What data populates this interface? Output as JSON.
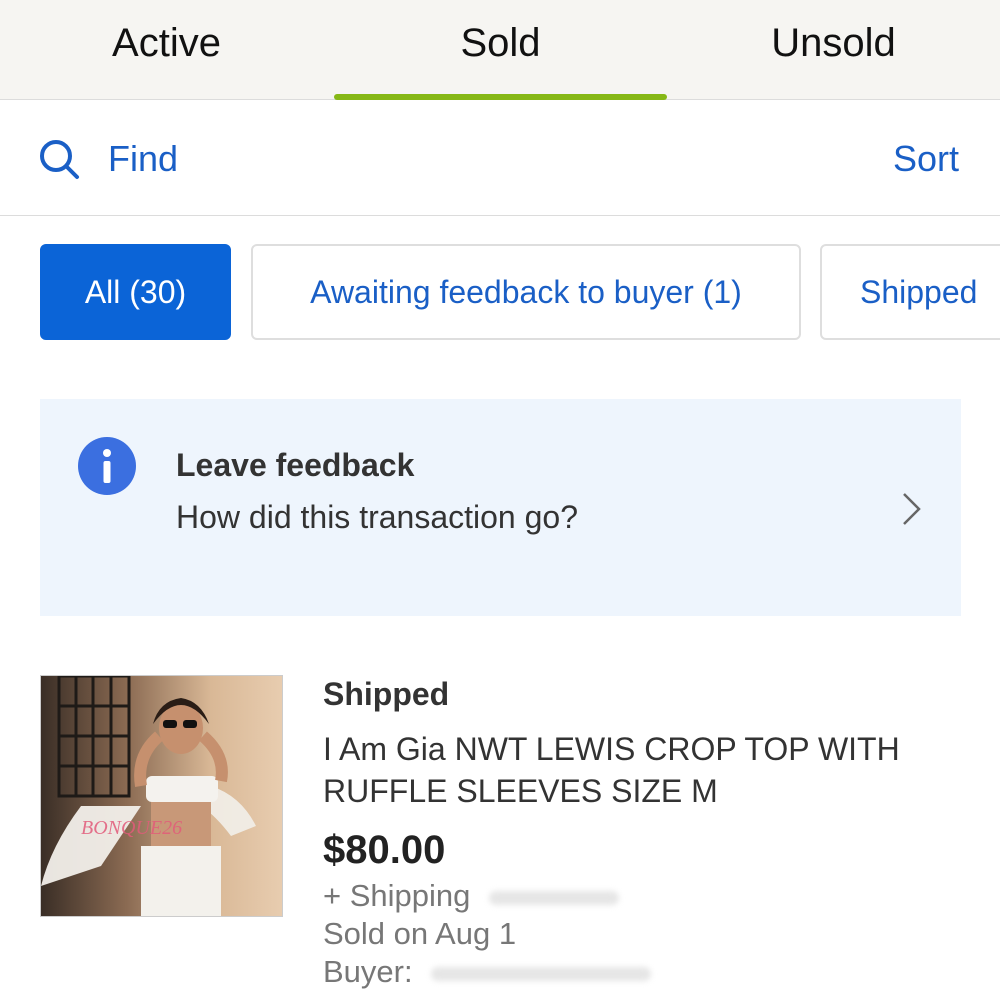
{
  "tabs": {
    "active_label": "Active",
    "sold_label": "Sold",
    "unsold_label": "Unsold",
    "selected": "Sold",
    "accent_color": "#86b817"
  },
  "search": {
    "find_label": "Find",
    "sort_label": "Sort",
    "icon": "search-icon"
  },
  "filters": [
    {
      "label": "All (30)",
      "selected": true
    },
    {
      "label": "Awaiting feedback to buyer (1)",
      "selected": false
    },
    {
      "label": "Shipped",
      "selected": false
    }
  ],
  "banner": {
    "icon": "info-icon",
    "title": "Leave feedback",
    "subtitle": "How did this transaction go?",
    "chevron_icon": "chevron-right-icon"
  },
  "listing": {
    "status": "Shipped",
    "title": "I Am Gia NWT LEWIS CROP TOP WITH RUFFLE SLEEVES SIZE M",
    "price": "$80.00",
    "shipping_label": "+ Shipping",
    "sold_date": "Sold on Aug 1",
    "buyer_label": "Buyer:",
    "watermark": "BONQUE26"
  },
  "colors": {
    "primary_blue": "#0b64d7",
    "link_blue": "#1a5fc6",
    "banner_bg": "#eef5fd",
    "info_icon": "#3b6fe0"
  }
}
